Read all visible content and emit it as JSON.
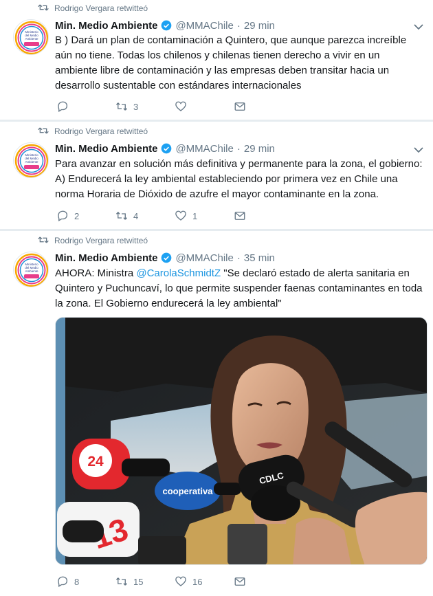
{
  "tweets": [
    {
      "retweet_line": "Rodrigo Vergara retwitteó",
      "name": "Min. Medio Ambiente",
      "handle": "@MMAChile",
      "time": "29 min",
      "text": "B ) Dará un plan de contaminación a Quintero, que aunque parezca increíble aún no tiene. Todas los chilenos  y chilenas tienen derecho a vivir en un ambiente libre de contaminación y las empresas deben transitar hacia un desarrollo sustentable con estándares internacionales",
      "replies": "",
      "retweets": "3",
      "likes": ""
    },
    {
      "retweet_line": "Rodrigo Vergara retwitteó",
      "name": "Min. Medio Ambiente",
      "handle": "@MMAChile",
      "time": "29 min",
      "text": "Para avanzar en solución más definitiva y permanente para la zona, el gobierno: A) Endurecerá  la ley ambiental estableciendo  por primera vez en Chile una norma Horaria de Dióxido de azufre el mayor contaminante en la zona.",
      "replies": "2",
      "retweets": "4",
      "likes": "1"
    },
    {
      "retweet_line": "Rodrigo Vergara retwitteó",
      "name": "Min. Medio Ambiente",
      "handle": "@MMAChile",
      "time": "35 min",
      "text_before": "AHORA: Ministra ",
      "mention": "@CarolaSchmidtZ",
      "text_after": "  \"Se declaró estado de alerta sanitaria en Quintero y Puchuncaví, lo que permite suspender faenas contaminantes en toda la zona. El Gobierno endurecerá la ley ambiental\"",
      "media": {
        "mic_24": "24",
        "mic_13": "13",
        "mic_cooperativa": "cooperativa",
        "mic_cdlc": "CDLC"
      },
      "replies": "8",
      "retweets": "15",
      "likes": "16"
    }
  ],
  "avatar_text": [
    "Ministerio",
    "del Medio",
    "Ambiente"
  ],
  "colors": {
    "verified": "#1da1f2",
    "link": "#1b95e0",
    "meta": "#657786",
    "divider": "#e6ecf0"
  },
  "icons": [
    "retweet-icon",
    "verified-icon",
    "chevron-down-icon",
    "reply-icon",
    "heart-icon",
    "message-icon"
  ]
}
